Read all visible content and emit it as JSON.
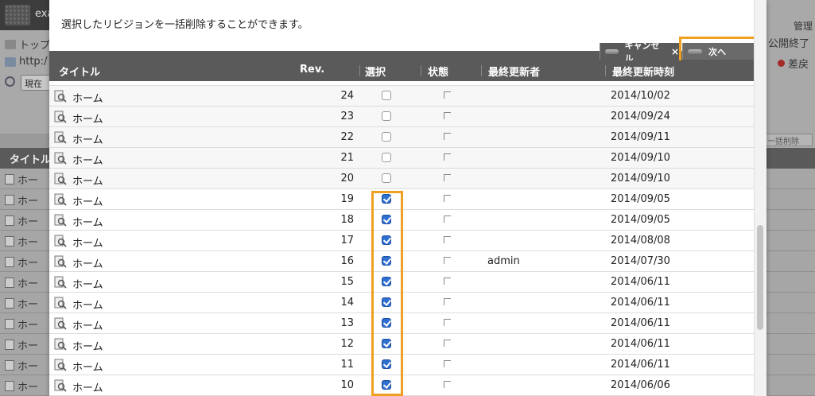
{
  "background": {
    "top_label": "exa",
    "left_items": [
      "トップ",
      "http:/",
      "現在"
    ],
    "admin_label": "管理",
    "status_label": "公開終了",
    "diff_label": "差戻",
    "bulk_label": "一括削除",
    "table_header": "タイトル",
    "row_label": "ホー"
  },
  "modal": {
    "message": "選択したリビジョンを一括削除することができます。",
    "toolbar": {
      "cancel_label": "キャンセル",
      "cancel_close": "×",
      "next_label": "次へ"
    },
    "columns": {
      "title": "タイトル",
      "rev": "Rev.",
      "select": "選択",
      "state": "状態",
      "updater": "最終更新者",
      "updated_at": "最終更新時刻"
    },
    "rows": [
      {
        "title": "ホーム",
        "rev": "24",
        "selected": false,
        "updater": "",
        "date": "2014/10/02"
      },
      {
        "title": "ホーム",
        "rev": "23",
        "selected": false,
        "updater": "",
        "date": "2014/09/24"
      },
      {
        "title": "ホーム",
        "rev": "22",
        "selected": false,
        "updater": "",
        "date": "2014/09/11"
      },
      {
        "title": "ホーム",
        "rev": "21",
        "selected": false,
        "updater": "",
        "date": "2014/09/10"
      },
      {
        "title": "ホーム",
        "rev": "20",
        "selected": false,
        "updater": "",
        "date": "2014/09/10"
      },
      {
        "title": "ホーム",
        "rev": "19",
        "selected": true,
        "updater": "",
        "date": "2014/09/05"
      },
      {
        "title": "ホーム",
        "rev": "18",
        "selected": true,
        "updater": "",
        "date": "2014/09/05"
      },
      {
        "title": "ホーム",
        "rev": "17",
        "selected": true,
        "updater": "",
        "date": "2014/08/08"
      },
      {
        "title": "ホーム",
        "rev": "16",
        "selected": true,
        "updater": "admin",
        "date": "2014/07/30"
      },
      {
        "title": "ホーム",
        "rev": "15",
        "selected": true,
        "updater": "",
        "date": "2014/06/11"
      },
      {
        "title": "ホーム",
        "rev": "14",
        "selected": true,
        "updater": "",
        "date": "2014/06/11"
      },
      {
        "title": "ホーム",
        "rev": "13",
        "selected": true,
        "updater": "",
        "date": "2014/06/11"
      },
      {
        "title": "ホーム",
        "rev": "12",
        "selected": true,
        "updater": "",
        "date": "2014/06/11"
      },
      {
        "title": "ホーム",
        "rev": "11",
        "selected": true,
        "updater": "",
        "date": "2014/06/11"
      },
      {
        "title": "ホーム",
        "rev": "10",
        "selected": true,
        "updater": "",
        "date": "2014/06/06"
      }
    ]
  },
  "colors": {
    "highlight": "#f0a020",
    "header_bg": "#5a5a5a",
    "checkbox_checked": "#2f6fd0"
  },
  "icons": {
    "row_icon": "page-search-icon",
    "next_icon": "triangle-right-icon",
    "cancel_icon": "close-icon"
  }
}
